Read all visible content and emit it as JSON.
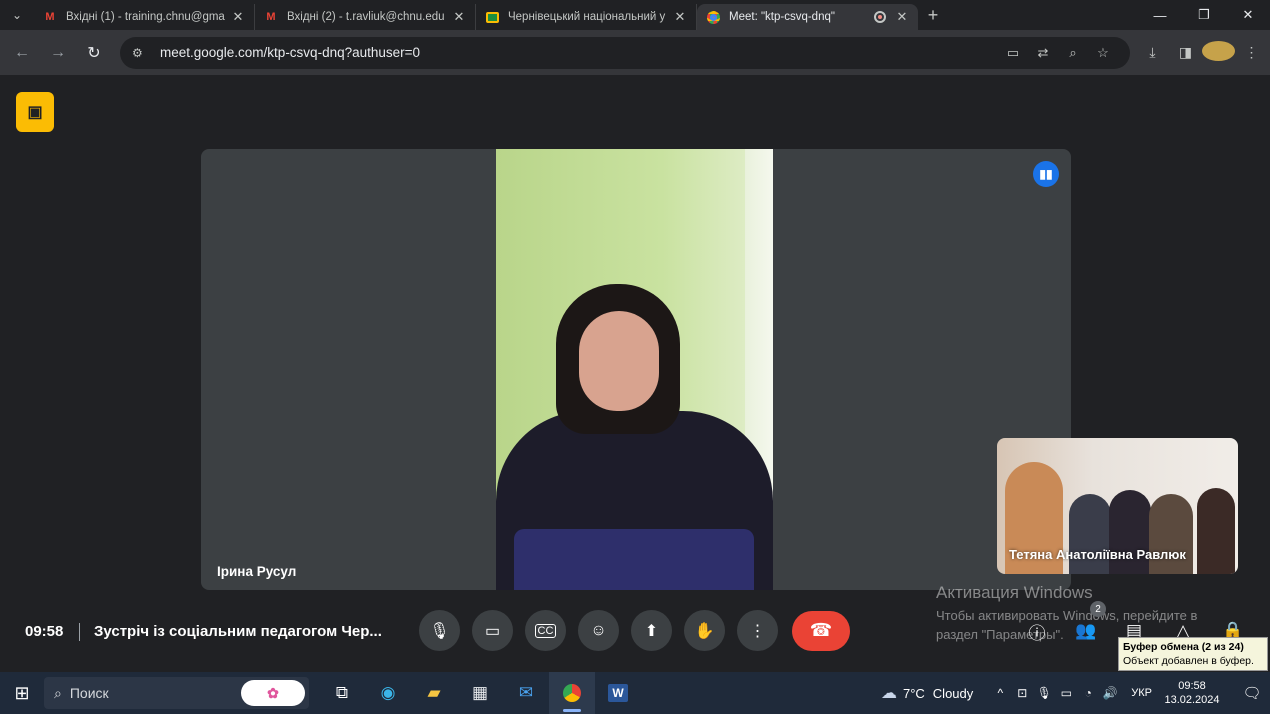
{
  "browser": {
    "tabs": [
      {
        "title": "Вхідні (1) - training.chnu@gma",
        "favicon": "gmail-icon"
      },
      {
        "title": "Вхідні (2) - t.ravliuk@chnu.edu",
        "favicon": "gmail-icon"
      },
      {
        "title": "Чернівецький національний у",
        "favicon": "classroom-icon"
      },
      {
        "title": "Meet: \"ktp-csvq-dnq\"",
        "favicon": "chrome-icon"
      }
    ],
    "url": "meet.google.com/ktp-csvq-dnq?authuser=0"
  },
  "meet": {
    "main_participant": "Ірина Русул",
    "self_participant": "Тетяна Анатоліївна Равлюк",
    "time": "09:58",
    "meeting_title": "Зустріч із соціальним педагогом Чер...",
    "participants_count": "2"
  },
  "windows_watermark": {
    "title": "Активация Windows",
    "line1": "Чтобы активировать Windows, перейдите в",
    "line2": "раздел \"Параметры\"."
  },
  "clipboard_tooltip": {
    "title": "Буфер обмена (2 из 24)",
    "subtitle": "Объект добавлен в буфер."
  },
  "taskbar": {
    "search_placeholder": "Поиск",
    "weather_temp": "7°C",
    "weather_desc": "Cloudy",
    "language": "УКР",
    "time": "09:58",
    "date": "13.02.2024"
  },
  "colors": {
    "end_call": "#ea4335",
    "recording_badge": "#fbbc04",
    "speaking_indicator": "#1a73e8"
  }
}
